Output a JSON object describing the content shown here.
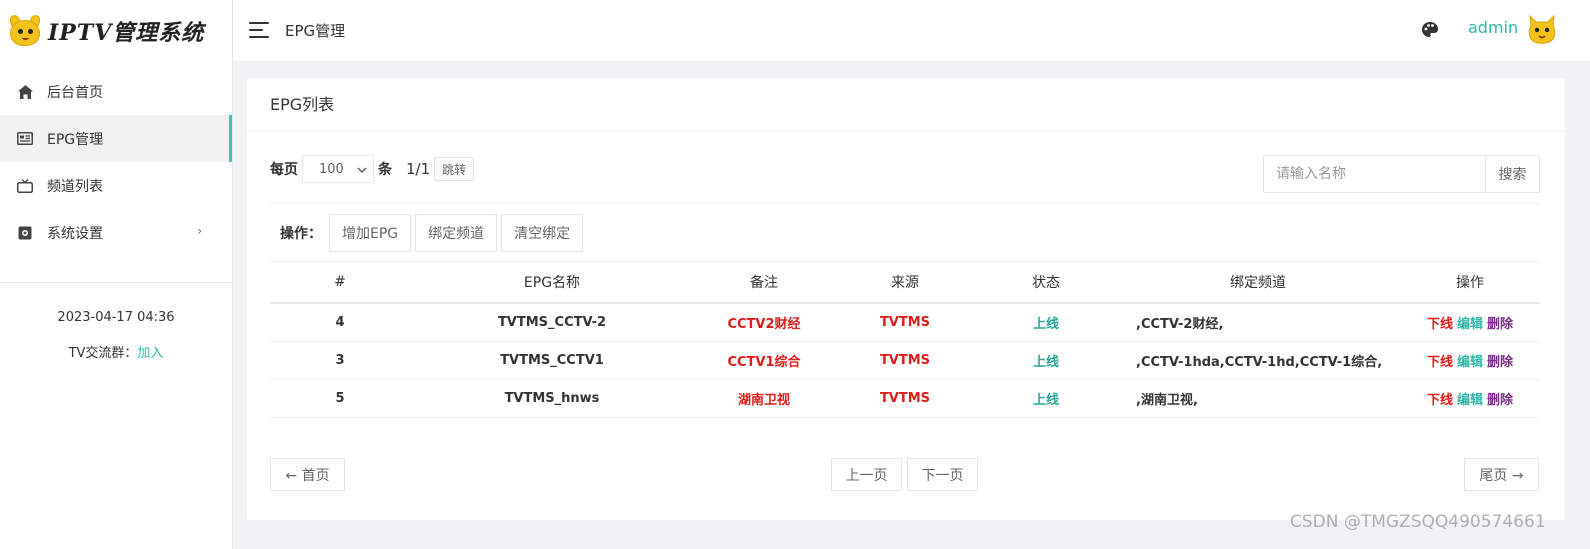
{
  "sidebar": {
    "brand_title": "IPTV管理系统",
    "menu": [
      {
        "label": "后台首页",
        "icon": "home-icon"
      },
      {
        "label": "EPG管理",
        "icon": "epg-icon",
        "active": true
      },
      {
        "label": "频道列表",
        "icon": "tv-icon"
      },
      {
        "label": "系统设置",
        "icon": "settings-icon",
        "has_children": true
      }
    ],
    "datetime": "2023-04-17 04:36",
    "group_label": "TV交流群：",
    "group_link": "加入"
  },
  "header": {
    "title": "EPG管理",
    "username": "admin"
  },
  "card": {
    "title": "EPG列表",
    "per_page_label": "每页",
    "per_page_value": "100",
    "per_page_unit": "条",
    "page_indicator": "1/1",
    "jump_label": "跳转",
    "search_placeholder": "请输入名称",
    "search_button": "搜索",
    "ops_label": "操作：",
    "ops_buttons": [
      "增加EPG",
      "绑定频道",
      "清空绑定"
    ]
  },
  "table": {
    "headers": [
      "#",
      "EPG名称",
      "备注",
      "来源",
      "状态",
      "绑定频道",
      "操作"
    ],
    "rows": [
      {
        "id": "4",
        "name": "TVTMS_CCTV-2",
        "remark": "CCTV2财经",
        "source": "TVTMS",
        "status": "上线",
        "bound": ",CCTV-2财经,"
      },
      {
        "id": "3",
        "name": "TVTMS_CCTV1",
        "remark": "CCTV1综合",
        "source": "TVTMS",
        "status": "上线",
        "bound": ",CCTV-1hda,CCTV-1hd,CCTV-1综合,"
      },
      {
        "id": "5",
        "name": "TVTMS_hnws",
        "remark": "湖南卫视",
        "source": "TVTMS",
        "status": "上线",
        "bound": ",湖南卫视,"
      }
    ],
    "actions": {
      "offline": "下线",
      "edit": "编辑",
      "delete": "删除"
    }
  },
  "pager": {
    "first": "← 首页",
    "prev": "上一页",
    "next": "下一页",
    "last": "尾页 →"
  },
  "watermark": "CSDN @TMGZSQQ490574661",
  "colors": {
    "accent": "#2db7a8",
    "danger": "#e21b1b",
    "delete": "#7b2a8a"
  }
}
